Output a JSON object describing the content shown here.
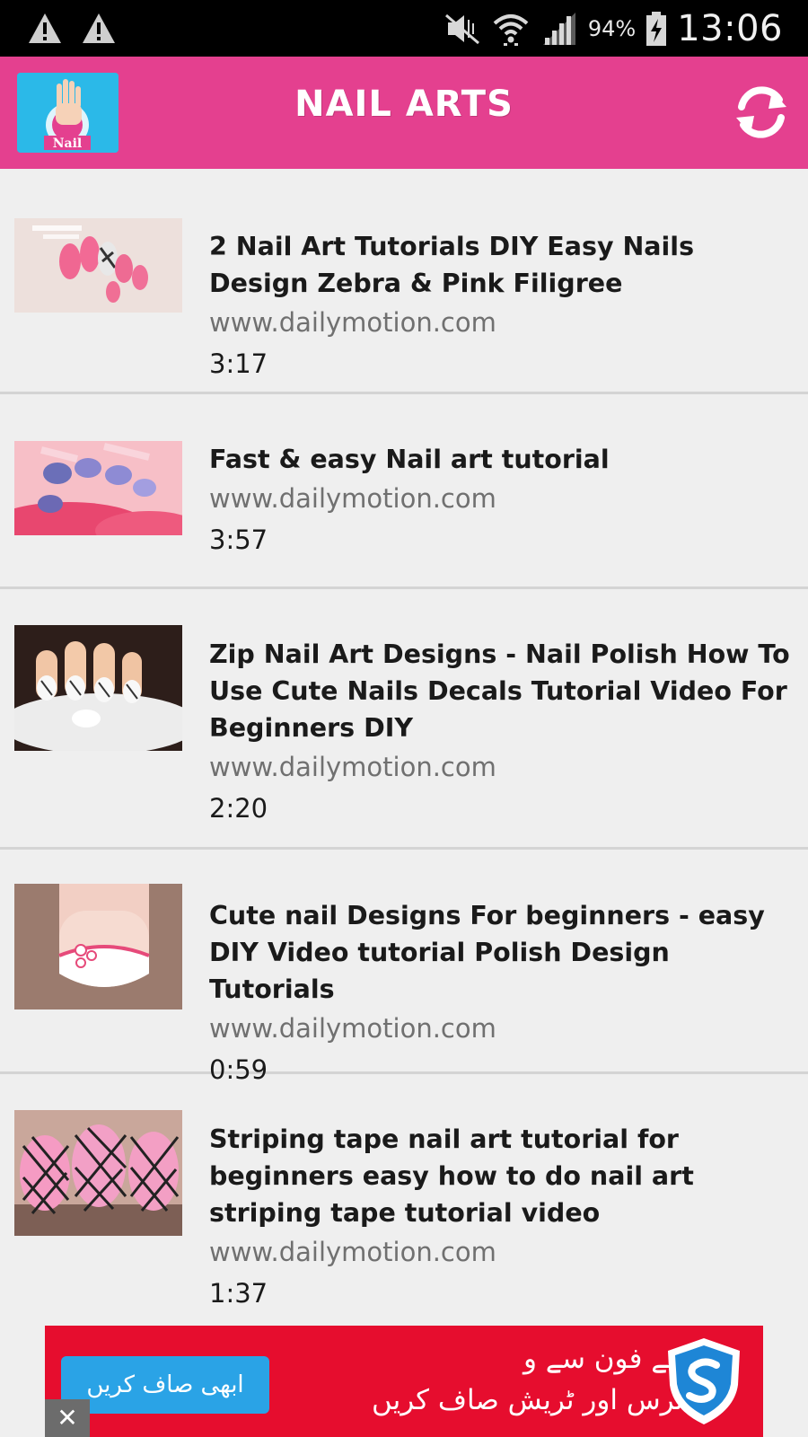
{
  "status_bar": {
    "battery": "94%",
    "time": "13:06",
    "icons": [
      "warning-icon",
      "warning-icon",
      "mute-icon",
      "wifi-icon",
      "signal-icon",
      "battery-charging-icon"
    ]
  },
  "app_bar": {
    "title": "NAIL ARTS",
    "logo_label": "Nail",
    "refresh_icon": "refresh-icon",
    "color": "#e4408f"
  },
  "videos": [
    {
      "title": "2 Nail Art Tutorials DIY Easy Nails Design Zebra & Pink Filigree",
      "source": "www.dailymotion.com",
      "duration": "3:17"
    },
    {
      "title": "Fast & easy Nail art tutorial",
      "source": "www.dailymotion.com",
      "duration": "3:57"
    },
    {
      "title": "Zip Nail Art Designs - Nail Polish How To Use Cute Nails Decals Tutorial Video For Beginners DIY",
      "source": "www.dailymotion.com",
      "duration": "2:20"
    },
    {
      "title": "Cute nail Designs For beginners - easy DIY Video tutorial Polish Design Tutorials",
      "source": "www.dailymotion.com",
      "duration": "0:59"
    },
    {
      "title": "Striping tape nail art tutorial for beginners easy how to do nail art striping tape tutorial video",
      "source": "www.dailymotion.com",
      "duration": "1:37"
    }
  ],
  "ad": {
    "button_label": "ابھی صاف کریں",
    "text_line1": "اپنے فون سے و",
    "text_line2": "ائرس اور ٹریش صاف کریں",
    "close_label": "✕",
    "color": "#e60d2e",
    "icon": "shield-icon"
  }
}
